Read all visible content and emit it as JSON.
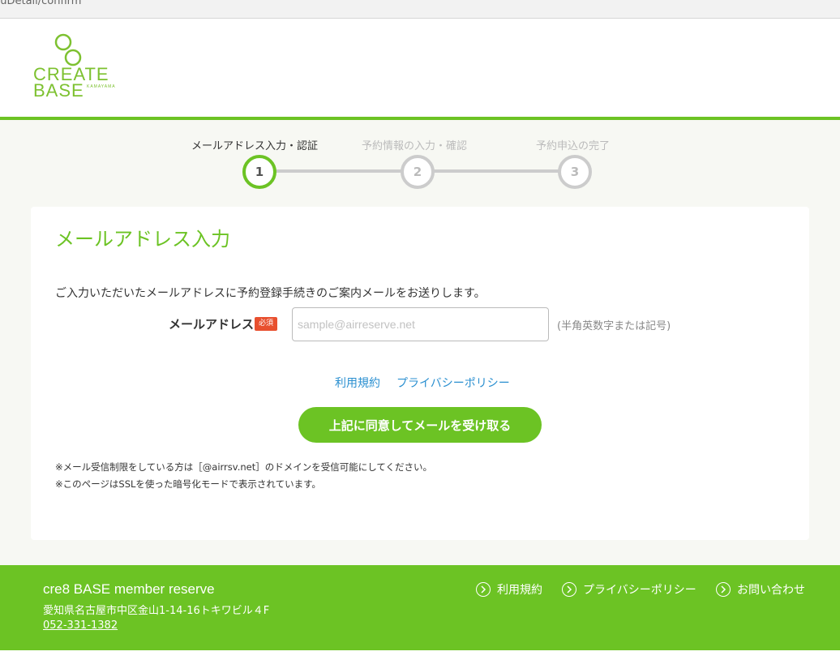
{
  "browser": {
    "url_fragment": "nuDetail/confirm"
  },
  "logo": {
    "line1": "CREATE",
    "line2": "BASE",
    "sub": "KAMAYAMA"
  },
  "steps": [
    {
      "label": "メールアドレス入力・認証",
      "number": "1",
      "active": true
    },
    {
      "label": "予約情報の入力・確認",
      "number": "2",
      "active": false
    },
    {
      "label": "予約申込の完了",
      "number": "3",
      "active": false
    }
  ],
  "form": {
    "title": "メールアドレス入力",
    "intro": "ご入力いただいたメールアドレスに予約登録手続きのご案内メールをお送りします。",
    "email_label": "メールアドレス",
    "required_badge": "必須",
    "email_placeholder": "sample@airreserve.net",
    "email_value": "",
    "email_hint": "(半角英数字または記号)",
    "terms_link": "利用規約",
    "privacy_link": "プライバシーポリシー",
    "agree_button": "上記に同意してメールを受け取る",
    "note1": "※メール受信制限をしている方は［@airrsv.net］のドメインを受信可能にしてください。",
    "note2": "※このページはSSLを使った暗号化モードで表示されています。"
  },
  "footer": {
    "name": "cre8 BASE member reserve",
    "address": "愛知県名古屋市中区金山1-14-16トキワビル４F",
    "phone": "052-331-1382",
    "links": [
      "利用規約",
      "プライバシーポリシー",
      "お問い合わせ"
    ]
  },
  "colors": {
    "brand_green": "#6cc324",
    "link_blue": "#2a8fd0",
    "required_red": "#e8502f"
  }
}
